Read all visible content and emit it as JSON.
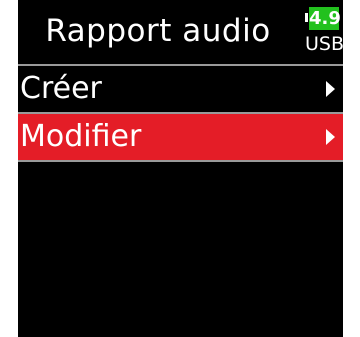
{
  "header": {
    "title": "Rapport audio",
    "battery": {
      "level": "4.9",
      "source": "USB"
    }
  },
  "menu": {
    "items": [
      {
        "label": "Créer",
        "selected": false
      },
      {
        "label": "Modifier",
        "selected": true
      }
    ]
  },
  "colors": {
    "background": "#000000",
    "selection": "#e41d27",
    "battery_fill": "#22c11e",
    "divider": "#9a9a9a"
  },
  "icons": {
    "menu_arrow": "chevron-right-icon",
    "battery": "battery-icon"
  }
}
